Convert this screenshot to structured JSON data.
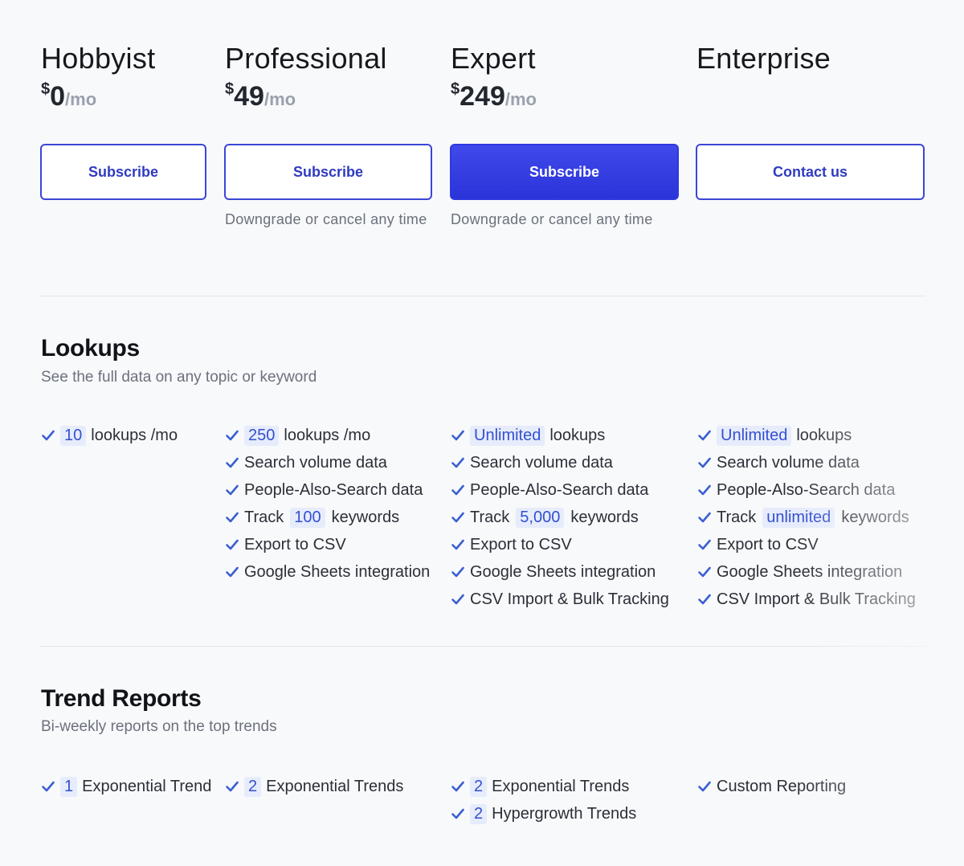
{
  "plans": [
    {
      "name": "Hobbyist",
      "currency": "$",
      "price": "0",
      "period": "/mo",
      "button": "Subscribe",
      "note": ""
    },
    {
      "name": "Professional",
      "currency": "$",
      "price": "49",
      "period": "/mo",
      "button": "Subscribe",
      "note": "Downgrade or cancel any time"
    },
    {
      "name": "Expert",
      "currency": "$",
      "price": "249",
      "period": "/mo",
      "button": "Subscribe",
      "note": "Downgrade or cancel any time"
    },
    {
      "name": "Enterprise",
      "currency": "",
      "price": "",
      "period": "",
      "button": "Contact us",
      "note": ""
    }
  ],
  "lookups": {
    "title": "Lookups",
    "subtitle": "See the full data on any topic or keyword",
    "columns": [
      [
        {
          "pre": "",
          "hl": "10",
          "post": "lookups /mo"
        }
      ],
      [
        {
          "pre": "",
          "hl": "250",
          "post": "lookups /mo"
        },
        {
          "pre": "Search volume data",
          "hl": "",
          "post": ""
        },
        {
          "pre": "People-Also-Search data",
          "hl": "",
          "post": ""
        },
        {
          "pre": "Track",
          "hl": "100",
          "post": "keywords"
        },
        {
          "pre": "Export to CSV",
          "hl": "",
          "post": ""
        },
        {
          "pre": "Google Sheets integration",
          "hl": "",
          "post": ""
        }
      ],
      [
        {
          "pre": "",
          "hl": "Unlimited",
          "post": "lookups"
        },
        {
          "pre": "Search volume data",
          "hl": "",
          "post": ""
        },
        {
          "pre": "People-Also-Search data",
          "hl": "",
          "post": ""
        },
        {
          "pre": "Track",
          "hl": "5,000",
          "post": "keywords"
        },
        {
          "pre": "Export to CSV",
          "hl": "",
          "post": ""
        },
        {
          "pre": "Google Sheets integration",
          "hl": "",
          "post": ""
        },
        {
          "pre": "CSV Import & Bulk Tracking",
          "hl": "",
          "post": ""
        }
      ],
      [
        {
          "pre": "",
          "hl": "Unlimited",
          "post": "lookups"
        },
        {
          "pre": "Search volume data",
          "hl": "",
          "post": ""
        },
        {
          "pre": "People-Also-Search data",
          "hl": "",
          "post": ""
        },
        {
          "pre": "Track",
          "hl": "unlimited",
          "post": "keywords"
        },
        {
          "pre": "Export to CSV",
          "hl": "",
          "post": ""
        },
        {
          "pre": "Google Sheets integration",
          "hl": "",
          "post": ""
        },
        {
          "pre": "CSV Import & Bulk Tracking",
          "hl": "",
          "post": ""
        }
      ]
    ]
  },
  "trends": {
    "title": "Trend Reports",
    "subtitle": "Bi-weekly reports on the top trends",
    "columns": [
      [
        {
          "pre": "",
          "hl": "1",
          "post": "Exponential Trend"
        }
      ],
      [
        {
          "pre": "",
          "hl": "2",
          "post": "Exponential Trends"
        }
      ],
      [
        {
          "pre": "",
          "hl": "2",
          "post": "Exponential Trends"
        },
        {
          "pre": "",
          "hl": "2",
          "post": "Hypergrowth Trends"
        }
      ],
      [
        {
          "pre": "Custom Reporting",
          "hl": "",
          "post": ""
        }
      ]
    ]
  },
  "icons": {
    "check": "check-icon"
  },
  "colors": {
    "accent": "#2f39dd",
    "check": "#3a5fd0",
    "chip_bg": "#e6ecfb"
  }
}
